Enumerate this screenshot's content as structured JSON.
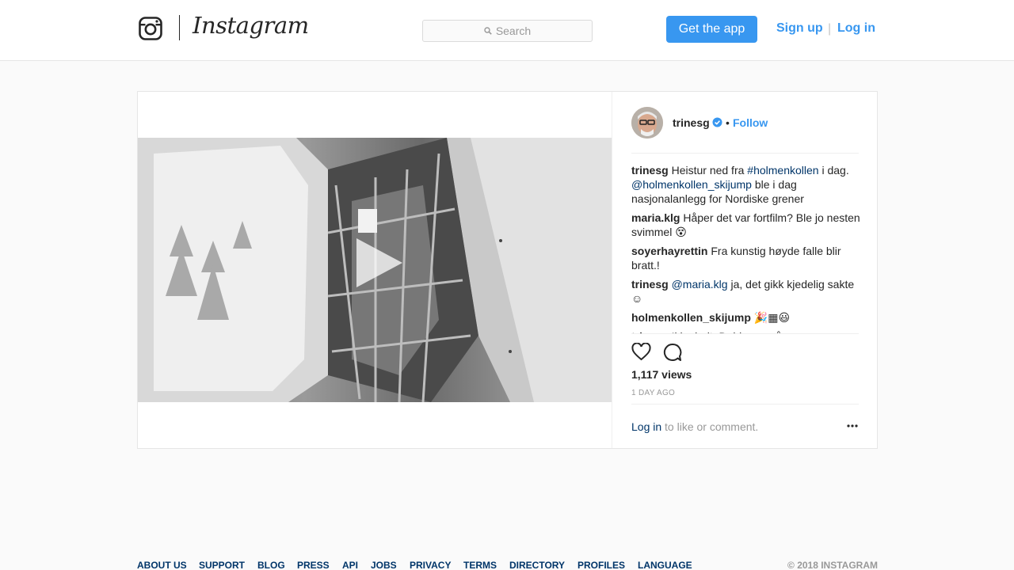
{
  "header": {
    "brand": "Instagram",
    "search_placeholder": "Search",
    "get_app_label": "Get the app",
    "signup_label": "Sign up",
    "separator": "|",
    "login_label": "Log in"
  },
  "post": {
    "username": "trinesg",
    "dot": "•",
    "follow_label": "Follow",
    "comments": [
      {
        "user": "trinesg",
        "parts": [
          {
            "t": "Heistur ned fra "
          },
          {
            "t": "#holmenkollen",
            "link": true
          },
          {
            "t": " i dag. "
          },
          {
            "t": "@holmenkollen_skijump",
            "link": true
          },
          {
            "t": " ble i dag nasjonalanlegg for Nordiske grener"
          }
        ]
      },
      {
        "user": "maria.klg",
        "parts": [
          {
            "t": "Håper det var fortfilm? Ble jo nesten svimmel 😵"
          }
        ]
      },
      {
        "user": "soyerhayrettin",
        "parts": [
          {
            "t": "Fra kunstig høyde falle blir bratt.!"
          }
        ]
      },
      {
        "user": "trinesg",
        "parts": [
          {
            "t": "@maria.klg",
            "link": true
          },
          {
            "t": " ja, det gikk kjedelig sakte ☺"
          }
        ]
      },
      {
        "user": "holmenkollen_skijump",
        "parts": [
          {
            "t": "🎉▦😃"
          }
        ]
      },
      {
        "user": "trinesg",
        "parts": [
          {
            "t": "Ikke helt. Dobbe og så..."
          }
        ]
      }
    ],
    "views": "1,117 views",
    "time_ago": "1 DAY AGO",
    "login_link": "Log in",
    "login_suffix": " to like or comment."
  },
  "footer": {
    "links": [
      "ABOUT US",
      "SUPPORT",
      "BLOG",
      "PRESS",
      "API",
      "JOBS",
      "PRIVACY",
      "TERMS",
      "DIRECTORY",
      "PROFILES",
      "LANGUAGE"
    ],
    "copyright": "© 2018 INSTAGRAM"
  },
  "colors": {
    "accent": "#3897f0",
    "link_dark": "#003569",
    "muted": "#999999"
  },
  "icons": [
    "instagram-camera-icon",
    "search-icon",
    "verified-badge-icon",
    "play-icon",
    "heart-icon",
    "comment-icon",
    "more-options-icon"
  ]
}
